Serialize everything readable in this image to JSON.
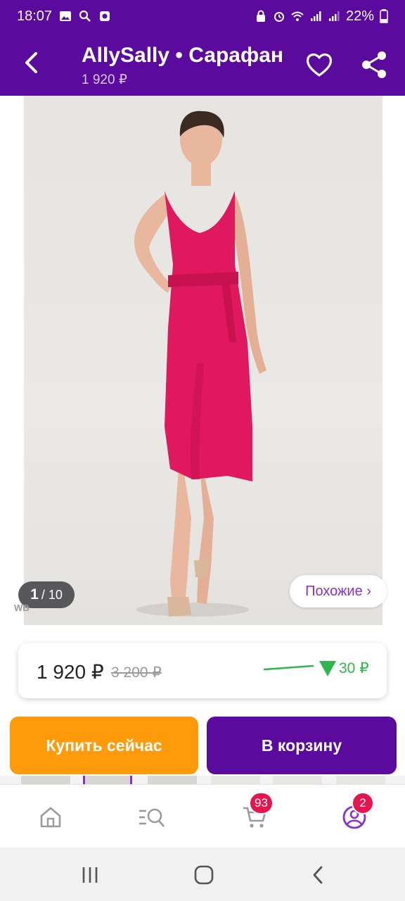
{
  "status_bar": {
    "time": "18:07",
    "battery": "22%"
  },
  "app_bar": {
    "title": "AllySally • Сарафан",
    "price": "1 920 ₽",
    "back_icon": "chevron-left-icon",
    "fav_icon": "heart-outline-icon",
    "share_icon": "share-icon"
  },
  "gallery": {
    "current": "1",
    "total": "/ 10",
    "watermark": "WB",
    "similar_label": "Похожие ›",
    "dress_color": "#e0185f"
  },
  "price_card": {
    "current": "1 920 ₽",
    "old": "3 200 ₽",
    "drop": "30 ₽",
    "drop_color": "#2eb84b"
  },
  "actions": {
    "buy_now": "Купить сейчас",
    "add_to_cart": "В корзину"
  },
  "bottom_nav": {
    "cart_badge": "93",
    "profile_badge": "2"
  },
  "colors": {
    "brand": "#5b0a9e",
    "buy": "#ff9a0a",
    "badge": "#e6154f"
  }
}
